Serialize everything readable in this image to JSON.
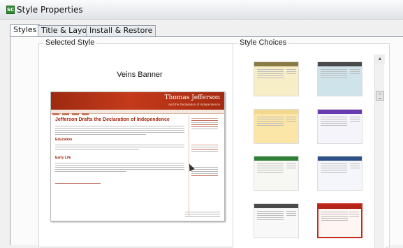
{
  "window": {
    "title": "Style Properties",
    "icon": "app-icon"
  },
  "tabs": [
    {
      "label": "Styles",
      "active": true
    },
    {
      "label": "Title & Layout",
      "active": false
    },
    {
      "label": "Install & Restore",
      "active": false
    }
  ],
  "selected_style": {
    "group_title": "Selected Style",
    "name": "Veins Banner",
    "preview": {
      "banner_title": "Thomas Jefferson",
      "banner_subtitle": "and the Declaration of Independence",
      "heading": "Jefferson Drafts the Declaration of Independence",
      "section_1": "Education",
      "section_2": "Early Life",
      "accent": "#a1290f"
    }
  },
  "style_choices": {
    "group_title": "Style Choices",
    "thumbnails": [
      {
        "name": "style-choice-1",
        "band": "#8a7a44",
        "body": "#f7edc7"
      },
      {
        "name": "style-choice-2",
        "band": "#4a4a4a",
        "body": "#cfe3ea"
      },
      {
        "name": "style-choice-3",
        "band": "#f2d88f",
        "body": "#fbe6a8"
      },
      {
        "name": "style-choice-4",
        "band": "#6a3ab0",
        "body": "#f6f4fb"
      },
      {
        "name": "style-choice-5",
        "band": "#2f7f34",
        "body": "#f7f8f4"
      },
      {
        "name": "style-choice-6",
        "band": "#2d4f88",
        "body": "#f4f6fb"
      },
      {
        "name": "style-choice-7",
        "band": "#4b4b4b",
        "body": "#f8f8f8"
      },
      {
        "name": "style-choice-8",
        "band": "#b5251a",
        "body": "#fff6f3",
        "selected": true
      }
    ]
  }
}
